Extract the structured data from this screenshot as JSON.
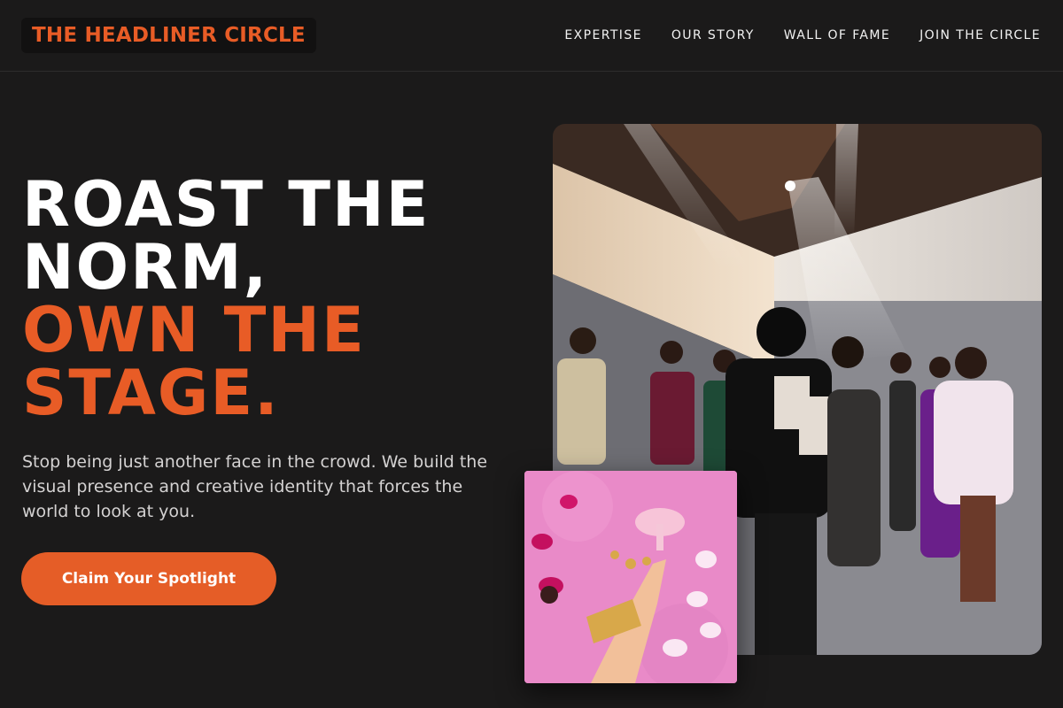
{
  "brand": {
    "logo": "THE HEADLINER CIRCLE",
    "accent_color": "#e85c26",
    "background_color": "#1b1a1a"
  },
  "nav": {
    "items": [
      {
        "label": "EXPERTISE"
      },
      {
        "label": "OUR STORY"
      },
      {
        "label": "WALL OF FAME"
      },
      {
        "label": "JOIN THE CIRCLE"
      }
    ]
  },
  "hero": {
    "title_line1": "ROAST THE",
    "title_line2": "NORM,",
    "title_accent_line1": "OWN THE",
    "title_accent_line2": "STAGE.",
    "subtitle": "Stop being just another face in the crowd. We build the visual presence and creative identity that forces the world to look at you.",
    "cta_label": "Claim Your Spotlight"
  },
  "images": {
    "main": "fashion-show-crowd-photo",
    "secondary": "pink-fur-jewelry-hand-photo"
  }
}
